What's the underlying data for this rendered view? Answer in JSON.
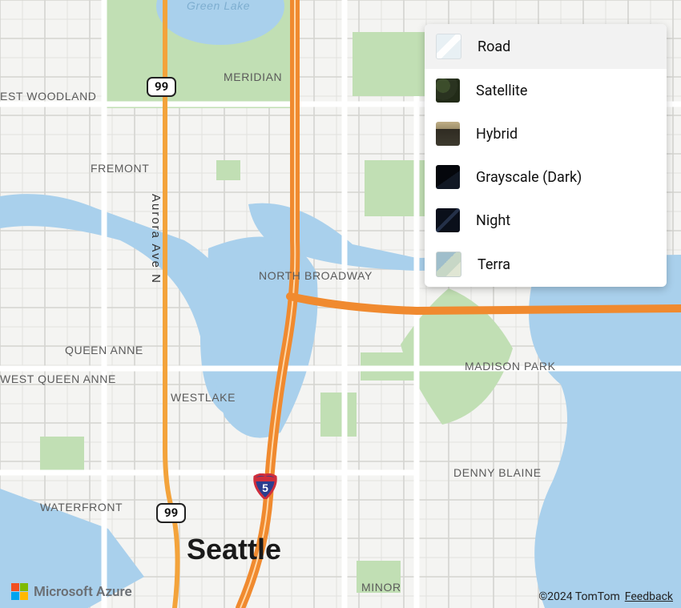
{
  "map": {
    "city_label": "Seattle",
    "water_label": "Green Lake",
    "street_label": "Aurora Ave N",
    "neighborhoods": {
      "meridian": "MERIDIAN",
      "est_woodland": "EST WOODLAND",
      "fremont": "FREMONT",
      "queen_anne": "QUEEN ANNE",
      "west_queen_anne": "WEST QUEEN ANNE",
      "westlake": "WESTLAKE",
      "north_broadway": "NORTH BROADWAY",
      "madison_park": "MADISON PARK",
      "denny_blaine": "DENNY BLAINE",
      "waterfront": "WATERFRONT",
      "minor": "MINOR"
    },
    "shields": {
      "sr99": "99",
      "i5": "5"
    }
  },
  "style_picker": {
    "options": [
      {
        "label": "Road",
        "thumb": "thumb-road",
        "selected": true
      },
      {
        "label": "Satellite",
        "thumb": "thumb-satellite",
        "selected": false
      },
      {
        "label": "Hybrid",
        "thumb": "thumb-hybrid",
        "selected": false
      },
      {
        "label": "Grayscale (Dark)",
        "thumb": "thumb-grayscale",
        "selected": false
      },
      {
        "label": "Night",
        "thumb": "thumb-night",
        "selected": false
      },
      {
        "label": "Terra",
        "thumb": "thumb-terra",
        "selected": false
      }
    ]
  },
  "attribution": {
    "brand": "Microsoft Azure",
    "copyright": "©2024 TomTom",
    "feedback": "Feedback"
  }
}
